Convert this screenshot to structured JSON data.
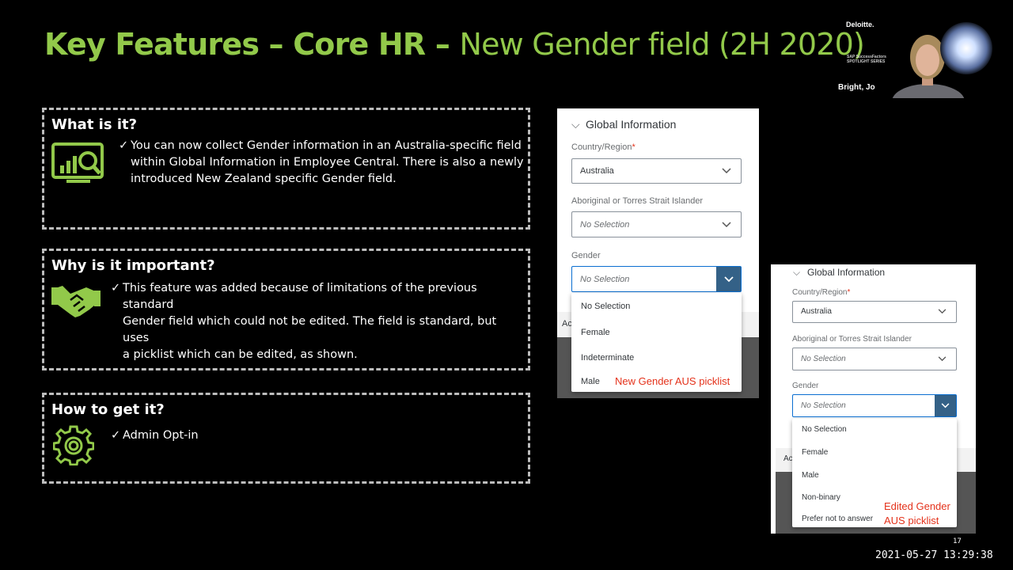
{
  "slide": {
    "title_bold": "Key Features – Core HR – ",
    "title_light": "New Gender field (2H 2020)",
    "colors": {
      "accent": "#92c94a",
      "background": "#000000",
      "link_red": "#e4321b",
      "dropdown_button": "#346187"
    },
    "page_number": "17",
    "timestamp": "2021-05-27 13:29:38"
  },
  "panels": [
    {
      "heading": "What is it?",
      "icon": "analytics-magnifier-icon",
      "check": "✓",
      "lines": [
        "You can now collect Gender information in an Australia-specific field",
        "within Global Information in Employee Central.  There is also a newly",
        "introduced New Zealand specific Gender field."
      ]
    },
    {
      "heading": "Why is it important?",
      "icon": "handshake-icon",
      "check": "✓",
      "lines": [
        "This feature was added because of limitations of the previous standard",
        "Gender field which could not be edited.  The field is standard, but uses",
        "a picklist which can be edited, as shown."
      ]
    },
    {
      "heading": "How to get it?",
      "icon": "gear-icon",
      "check": "✓",
      "lines": [
        "Admin Opt-in"
      ]
    }
  ],
  "form_new": {
    "section": "Global Information",
    "country_label": "Country/Region",
    "required_mark": "*",
    "country_value": "Australia",
    "aboriginal_label": "Aboriginal or Torres Strait Islander",
    "aboriginal_value": "No Selection",
    "gender_label": "Gender",
    "gender_value": "No Selection",
    "footer_text": "Ac",
    "options": [
      "No Selection",
      "Female",
      "Indeterminate",
      "Male"
    ],
    "caption": "New Gender AUS picklist"
  },
  "form_edited": {
    "section": "Global Information",
    "country_label": "Country/Region",
    "required_mark": "*",
    "country_value": "Australia",
    "aboriginal_label": "Aboriginal or Torres Strait Islander",
    "aboriginal_value": "No Selection",
    "gender_label": "Gender",
    "gender_value": "No Selection",
    "footer_text": "Ac",
    "options": [
      "No Selection",
      "Female",
      "Male",
      "Non-binary",
      "Prefer not to answer"
    ],
    "caption_line1": "Edited Gender",
    "caption_line2": "AUS picklist"
  },
  "video": {
    "brand": "Deloitte.",
    "series_line1": "SAP SuccessFactors",
    "series_line2": "SPOTLIGHT SERIES",
    "speaker": "Bright, Jo"
  }
}
